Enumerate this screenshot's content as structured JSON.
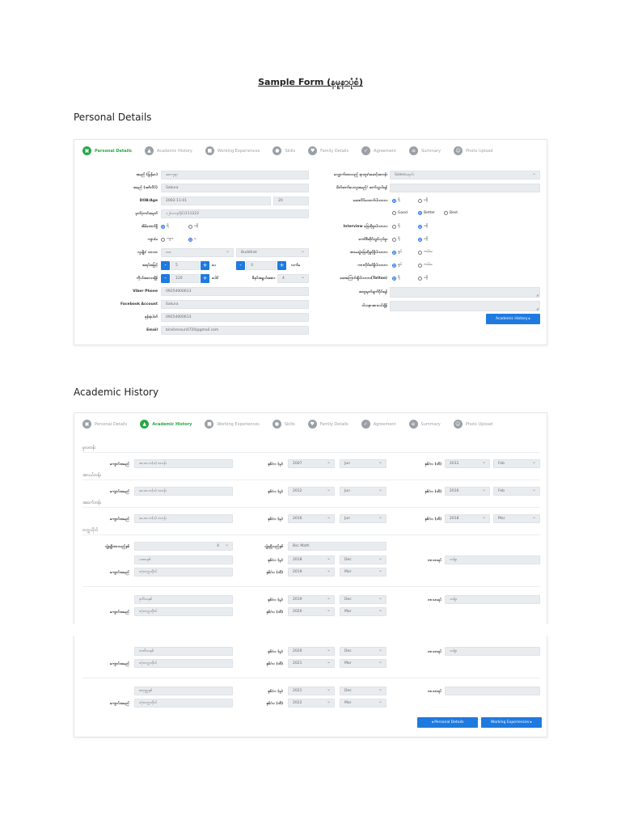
{
  "page_title": "Sample Form (နမူနာပုံစံ)",
  "headings": {
    "personal": "Personal Details",
    "academic": "Academic History"
  },
  "steps": [
    {
      "label": "Personal Details",
      "icon": "id-card-icon"
    },
    {
      "label": "Academic History",
      "icon": "graduation-cap-icon"
    },
    {
      "label": "Working Experiences",
      "icon": "briefcase-icon"
    },
    {
      "label": "Skills",
      "icon": "skills-icon"
    },
    {
      "label": "Family Details",
      "icon": "family-icon"
    },
    {
      "label": "Agreement",
      "icon": "handshake-icon"
    },
    {
      "label": "Summary",
      "icon": "document-icon"
    },
    {
      "label": "Photo Upload",
      "icon": "user-icon"
    }
  ],
  "personal": {
    "left": {
      "name_mm": {
        "label": "အမည် (မြန်မာ)",
        "value": "ဆာကူရာ"
      },
      "name_en": {
        "label": "အမည် (အင်္ဂလိပ်)",
        "value": "Sakura"
      },
      "dob": {
        "label": "DOB/Age",
        "value": "2002-11-01",
        "age": "20"
      },
      "nrc": {
        "label": "မှတ်ပုံတင်အမှတ်",
        "value": "၁၂/ဗဟန(နိုင်)111222"
      },
      "marital": {
        "label": "အိမ်ထောင်ရှိ",
        "opt1": "ရှိ",
        "opt2": "မရှိ"
      },
      "gender": {
        "label": "ကျား/မ",
        "opt1": "ကျား",
        "opt2": "မ"
      },
      "race": {
        "label": "လူမျိုး/ ဘာသာ",
        "value": "ဗမာ",
        "religion": "Buddhist"
      },
      "height": {
        "label": "အရပ်အမြင့်",
        "ft": "5",
        "ft_unit": "ပေ",
        "inch": "3",
        "inch_unit": "လက်မ"
      },
      "weight": {
        "label": "ကိုယ်အလေးချိန်",
        "value": "120",
        "unit": "ပေါင်",
        "shoe_label": "ဖိနပ်အရွယ်အစား",
        "shoe": "4"
      },
      "viber": {
        "label": "Viber Phone",
        "value": "09254000613"
      },
      "facebook": {
        "label": "Facebook Account",
        "value": "Sakura"
      },
      "phone": {
        "label": "ဖုန်းနံပါတ်",
        "value": "09254000613"
      },
      "email": {
        "label": "Email",
        "value": "binshensun0720@gmail.com"
      }
    },
    "right": {
      "apply_pos": {
        "label": "လျှောက်ထားသည့် ရာထူး/အဆင့်အတန်း",
        "value": "Sales/ရောင်း"
      },
      "ref": {
        "label": "မိတ်ဆက်ပေးသူအမည်/ ဆက်သွယ်ရန်",
        "value": ""
      },
      "q1": {
        "label": "ဆေးလိပ်သောက်ပါသလား",
        "opt1": "ရှိ",
        "opt2": "မရှိ"
      },
      "q1b": {
        "opt1": "Good",
        "opt2": "Better",
        "opt3": "Best"
      },
      "q2": {
        "label": "Interview ဖြေဆိုဖူးပါသလား",
        "opt1": "ရှိ",
        "opt2": "မရှိ"
      },
      "q3": {
        "label": "ကော်ဖီဆိုင်တွင်လုပ်ဖူး",
        "opt1": "ရှိ",
        "opt2": "မရှိ"
      },
      "q4": {
        "label": "စာမေးပွဲဖြေဆိုခွင့်ရှိပါသလား",
        "opt1": "ရှုပ်",
        "opt2": "ကမ်းမ"
      },
      "q5": {
        "label": "ကားလိုင်စင်ရှိပါသလား",
        "opt1": "ရှုပ်",
        "opt2": "ကမ်းမ"
      },
      "q6": {
        "label": "ဆေးကြောင်းရှိပါသလား(Tattoo)",
        "opt1": "ရှိ",
        "opt2": "မရှိ"
      },
      "note1_label": "အထူးမှတ်ချက်ပိုင်းရန်",
      "note2_label": "ဝါသနာအားလပ်ချိန်",
      "next_button": "Academic History ▸"
    }
  },
  "academic": {
    "primary_heading": "မူလတန်း",
    "middle_heading": "အလယ်တန်း",
    "high_heading": "အထက်တန်း",
    "univ_heading": "တက္ကသိုလ်",
    "school_label": "ကျောင်းအမည်",
    "from_label": "နှစ်/လ (မှ)",
    "to_label": "နှစ်/လ (ထိ)",
    "major_label": "ဘာသာရပ်",
    "rows": [
      {
        "school": "အ.ထ.က(၁) ဗဟန်း",
        "from_y": "2007",
        "from_m": "Jun",
        "to_y": "2012",
        "to_m": "Feb"
      },
      {
        "school": "အ.ထ.က(၁) ဗဟန်း",
        "from_y": "2012",
        "from_m": "Jun",
        "to_y": "2016",
        "to_m": "Feb"
      },
      {
        "school": "အ.ထ.က(၁) ဗဟန်း",
        "from_y": "2016",
        "from_m": "Jun",
        "to_y": "2018",
        "to_m": "Mar"
      }
    ],
    "univ_status_label": "ဘွဲ့ရရှိထားသည့်နှစ်",
    "univ_status_value": "4",
    "degree_label": "ဘွဲ့ရရှိသည့်နှစ်",
    "degree_value": "Bsc Math",
    "univ_rows": [
      {
        "year": "ပထမနှစ်",
        "school": "ဒဂုံတက္ကသိုလ်",
        "from_y": "2018",
        "from_m": "Dec",
        "to_y": "2019",
        "to_m": "Mar",
        "major": "သင်္ချာ"
      },
      {
        "year": "ဒုတိယနှစ်",
        "school": "ဒဂုံတက္ကသိုလ်",
        "from_y": "2019",
        "from_m": "Dec",
        "to_y": "2020",
        "to_m": "Mar",
        "major": "သင်္ချာ"
      },
      {
        "year": "တတိယနှစ်",
        "school": "ဒဂုံတက္ကသိုလ်",
        "from_y": "2020",
        "from_m": "Dec",
        "to_y": "2021",
        "to_m": "Mar",
        "major": "သင်္ချာ"
      },
      {
        "year": "စတုတ္ထနှစ်",
        "school": "ဒဂုံတက္ကသိုလ်",
        "from_y": "2021",
        "from_m": "Dec",
        "to_y": "2022",
        "to_m": "Mar",
        "major": ""
      }
    ],
    "prev_button": "◂ Personal Details",
    "next_button": "Working Experiences ▸"
  }
}
